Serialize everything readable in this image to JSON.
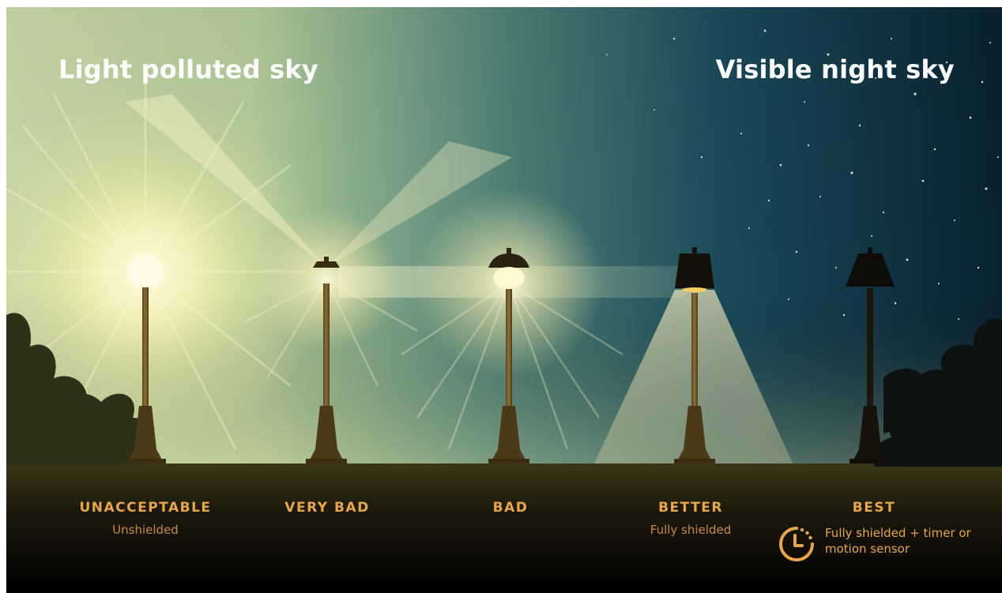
{
  "titles": {
    "left": "Light polluted sky",
    "right": "Visible night sky"
  },
  "lamps": [
    {
      "rating": "UNACCEPTABLE",
      "description": "Unshielded"
    },
    {
      "rating": "VERY BAD",
      "description": ""
    },
    {
      "rating": "BAD",
      "description": ""
    },
    {
      "rating": "BETTER",
      "description": "Fully shielded"
    },
    {
      "rating": "BEST",
      "description": "Fully shielded + timer or motion sensor"
    }
  ],
  "icons": {
    "timer": "clock-timer-icon"
  },
  "colors": {
    "label_gold": "#e8a64a",
    "sky_polluted": "#c6d8a6",
    "sky_night": "#0c2a3a",
    "lamp_light": "#fff6c8"
  }
}
